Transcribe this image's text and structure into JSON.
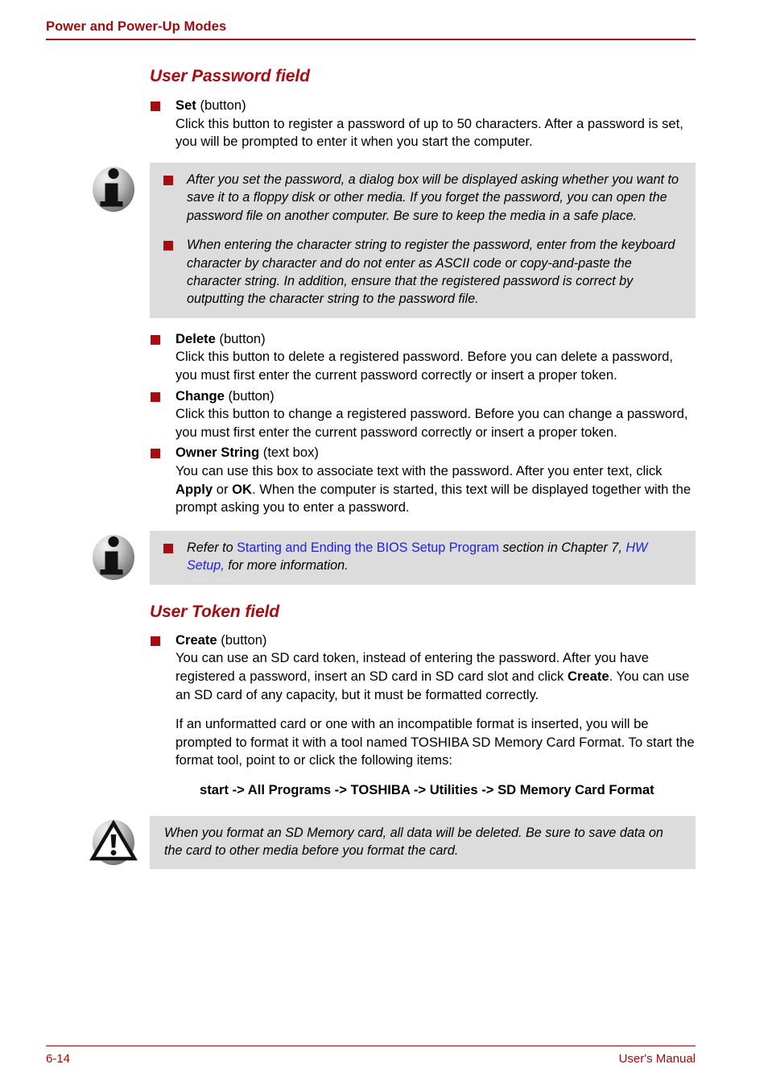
{
  "header": {
    "title": "Power and Power-Up Modes",
    "rule_color": "#9e0b0f"
  },
  "colors": {
    "accent_red": "#a80c10",
    "header_red": "#9e0b0f",
    "link_blue": "#2222dd",
    "callout_bg": "#dcdcdc"
  },
  "sections": [
    {
      "heading": "User Password field",
      "items": [
        {
          "title": "Set",
          "title_suffix": " (button)",
          "body": "Click this button to register a password of up to 50 characters. After a password is set, you will be prompted to enter it when you start the computer."
        }
      ]
    }
  ],
  "note_1": {
    "icon": "info-icon",
    "bullets": [
      "After you set the password, a dialog box will be displayed asking whether you want to save it to a floppy disk or other media. If you forget the password, you can open the password file on another computer. Be sure to keep the media in a safe place.",
      "When entering the character string to register the password, enter from the keyboard character by character and do not enter as ASCII code or copy-and-paste the character string. In addition, ensure that the registered password is correct by outputting the character string to the password file."
    ]
  },
  "items_after_note_1": [
    {
      "title": "Delete",
      "title_suffix": " (button)",
      "body": "Click this button to delete a registered password. Before you can delete a password, you must first enter the current password correctly or insert a proper token."
    },
    {
      "title": "Change",
      "title_suffix": " (button)",
      "body": "Click this button to change a registered password. Before you can change a password, you must first enter the current password correctly or insert a proper token."
    }
  ],
  "owner_string": {
    "title": "Owner String",
    "title_suffix": " (text box)",
    "body_part_1": "You can use this box to associate text with the password. After you enter text, click ",
    "emphasis_1": "Apply",
    "body_part_2": " or ",
    "emphasis_2": "OK",
    "body_part_3": ". When the computer is started, this text will be displayed together with the prompt asking you to enter a password."
  },
  "note_2": {
    "icon": "info-icon",
    "text_part_1": "Refer to ",
    "link_1": "Starting and Ending the BIOS Setup Program",
    "text_part_2": " section in Chapter 7, ",
    "link_2": "HW Setup,",
    "text_part_3": " for more information."
  },
  "section_2": {
    "heading": "User Token field",
    "create": {
      "title": "Create",
      "title_suffix": " (button)",
      "body_part_1": "You can use an SD card token, instead of entering the password. After you have registered a password, insert an SD card in SD card slot and click ",
      "emphasis_1": "Create",
      "body_part_2": ". You can use an SD card of any capacity, but it must be formatted correctly."
    },
    "paragraph": "If an unformatted card or one with an incompatible format is inserted, you will be prompted to format it with a tool named TOSHIBA SD Memory Card Format. To start the format tool, point to or click the following items:",
    "menu_path": "start -> All Programs -> TOSHIBA -> Utilities -> SD Memory Card Format"
  },
  "warning": {
    "icon": "warning-icon",
    "text": "When you format an SD Memory card, all data will be deleted. Be sure to save data on the card to other media before you format the card."
  },
  "footer": {
    "page_number": "6-14",
    "manual_label": "User's Manual"
  }
}
